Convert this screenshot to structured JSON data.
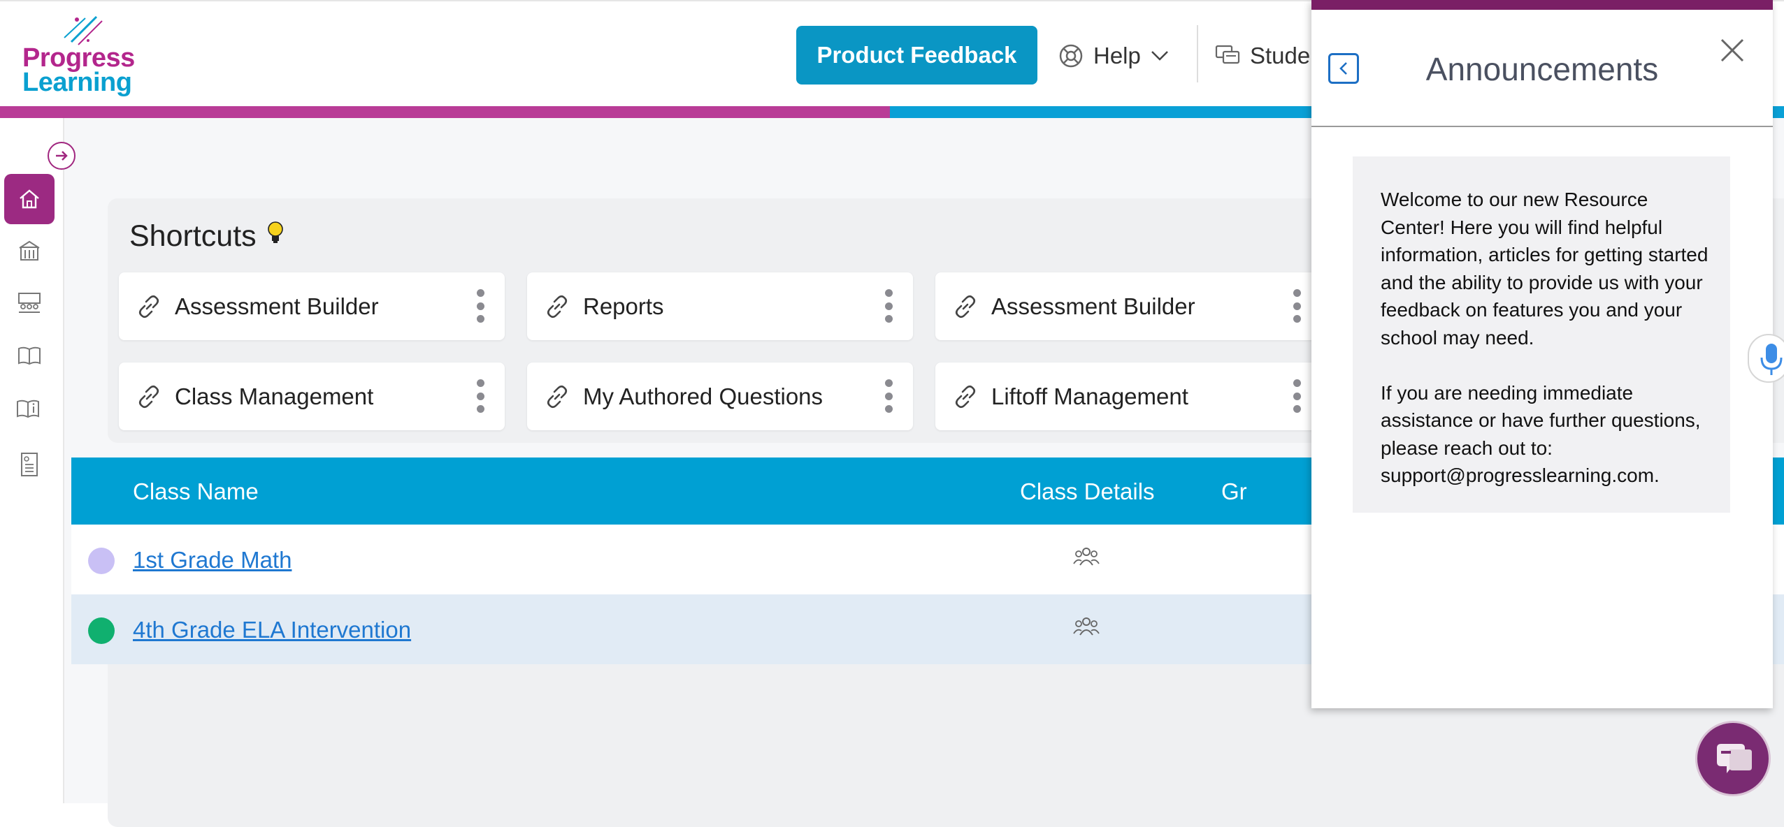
{
  "app": {
    "logo_line1": "Progress",
    "logo_line2": "Learning"
  },
  "header": {
    "product_feedback": "Product Feedback",
    "help": "Help",
    "student_partial": "Stude"
  },
  "colors": {
    "brand_magenta": "#b3268c",
    "brand_blue": "#0aa0d0",
    "button_blue": "#0a96c4",
    "table_header": "#00a0d3",
    "active_nav": "#9c2a82"
  },
  "sidebar": {
    "items": [
      {
        "icon": "home-icon",
        "active": true
      },
      {
        "icon": "school-icon",
        "active": false
      },
      {
        "icon": "classroom-icon",
        "active": false
      },
      {
        "icon": "book-icon",
        "active": false
      },
      {
        "icon": "book-info-icon",
        "active": false
      },
      {
        "icon": "report-icon",
        "active": false
      }
    ]
  },
  "shortcuts": {
    "title": "Shortcuts",
    "items": [
      {
        "label": "Assessment Builder"
      },
      {
        "label": "Reports"
      },
      {
        "label": "Assessment Builder"
      },
      {
        "label": "Class Management"
      },
      {
        "label": "My Authored Questions"
      },
      {
        "label": "Liftoff Management"
      }
    ]
  },
  "table": {
    "headers": {
      "class_name": "Class Name",
      "class_details": "Class Details",
      "gr_partial": "Gr"
    },
    "rows": [
      {
        "name": "1st Grade Math",
        "dot_color": "#c9c0f5"
      },
      {
        "name": "4th Grade ELA Intervention",
        "dot_color": "#10b06f"
      }
    ]
  },
  "announcements": {
    "title": "Announcements",
    "body": "Welcome to our new Resource Center! Here you will find helpful information, articles for getting started and the ability to provide us with your feedback on features you and your school may need.\n\nIf you are needing immediate assistance or have further questions, please reach out to: support@progresslearning.com."
  }
}
